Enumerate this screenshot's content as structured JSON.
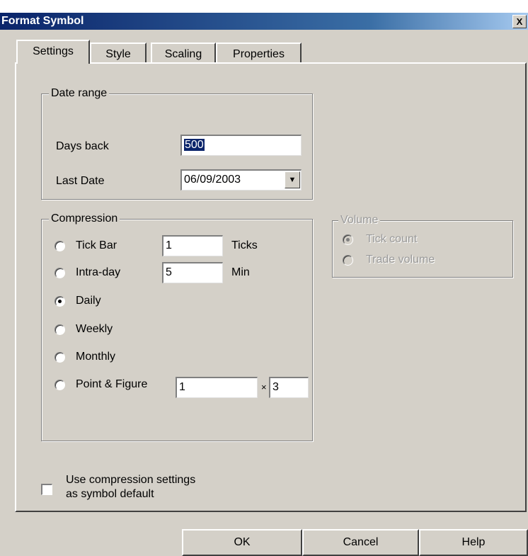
{
  "window": {
    "title": "Format Symbol",
    "close_label": "X"
  },
  "tabs": [
    "Settings",
    "Style",
    "Scaling",
    "Properties"
  ],
  "date_range": {
    "legend": "Date range",
    "days_back_label": "Days back",
    "days_back_value": "500",
    "last_date_label": "Last Date",
    "last_date_value": "06/09/2003"
  },
  "compression": {
    "legend": "Compression",
    "tick_bar_label": "Tick Bar",
    "tick_bar_value": "1",
    "tick_bar_unit": "Ticks",
    "intraday_label": "Intra-day",
    "intraday_value": "5",
    "intraday_unit": "Min",
    "daily_label": "Daily",
    "weekly_label": "Weekly",
    "monthly_label": "Monthly",
    "pnf_label": "Point & Figure",
    "pnf_value1": "1",
    "pnf_times": "×",
    "pnf_value2": "3",
    "selected": "Daily"
  },
  "volume": {
    "legend": "Volume",
    "tick_count_label": "Tick count",
    "trade_volume_label": "Trade volume",
    "enabled": false
  },
  "default_checkbox": {
    "label_line1": "Use compression settings",
    "label_line2": "as symbol default",
    "checked": false
  },
  "buttons": {
    "ok": "OK",
    "cancel": "Cancel",
    "help": "Help"
  },
  "colors": {
    "dialog_bg": "#d4d0c8",
    "titlebar": "#0a246a",
    "disabled_text": "#9a9a9a"
  }
}
